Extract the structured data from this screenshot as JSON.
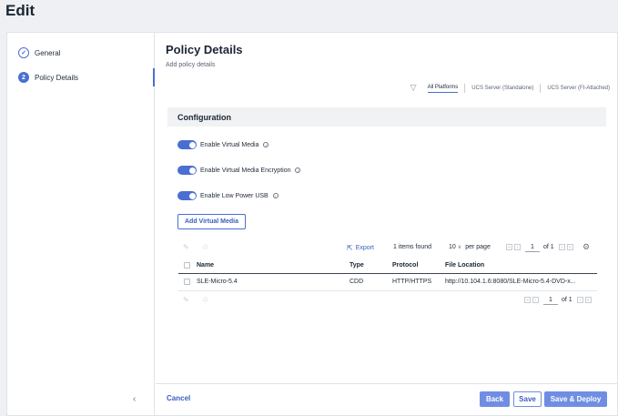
{
  "page": {
    "title": "Edit"
  },
  "steps": [
    {
      "label": "General",
      "marker": "✓"
    },
    {
      "label": "Policy Details",
      "marker": "2"
    }
  ],
  "main": {
    "title": "Policy Details",
    "subtitle": "Add policy details"
  },
  "platform_tabs": [
    "All Platforms",
    "UCS Server (Standalone)",
    "UCS Server (FI-Attached)"
  ],
  "configuration": {
    "header": "Configuration",
    "toggles": [
      {
        "label": "Enable Virtual Media",
        "on": true
      },
      {
        "label": "Enable Virtual Media Encryption",
        "on": true
      },
      {
        "label": "Enable Low Power USB",
        "on": true
      }
    ],
    "add_button": "Add Virtual Media"
  },
  "table": {
    "export_label": "Export",
    "items_found": "1 items found",
    "per_page_value": "10",
    "per_page_label": "per page",
    "page": "1",
    "of_pages": "of 1",
    "columns": [
      "Name",
      "Type",
      "Protocol",
      "File Location"
    ],
    "rows": [
      [
        "SLE-Micro-5.4",
        "CDD",
        "HTTP/HTTPS",
        "http://10.104.1.6:8080/SLE-Micro-5.4-DVD-x..."
      ]
    ]
  },
  "footer": {
    "cancel": "Cancel",
    "back": "Back",
    "save": "Save",
    "save_deploy": "Save & Deploy"
  },
  "colors": {
    "accent": "#4a6fd1",
    "button": "#6f8ee3"
  }
}
